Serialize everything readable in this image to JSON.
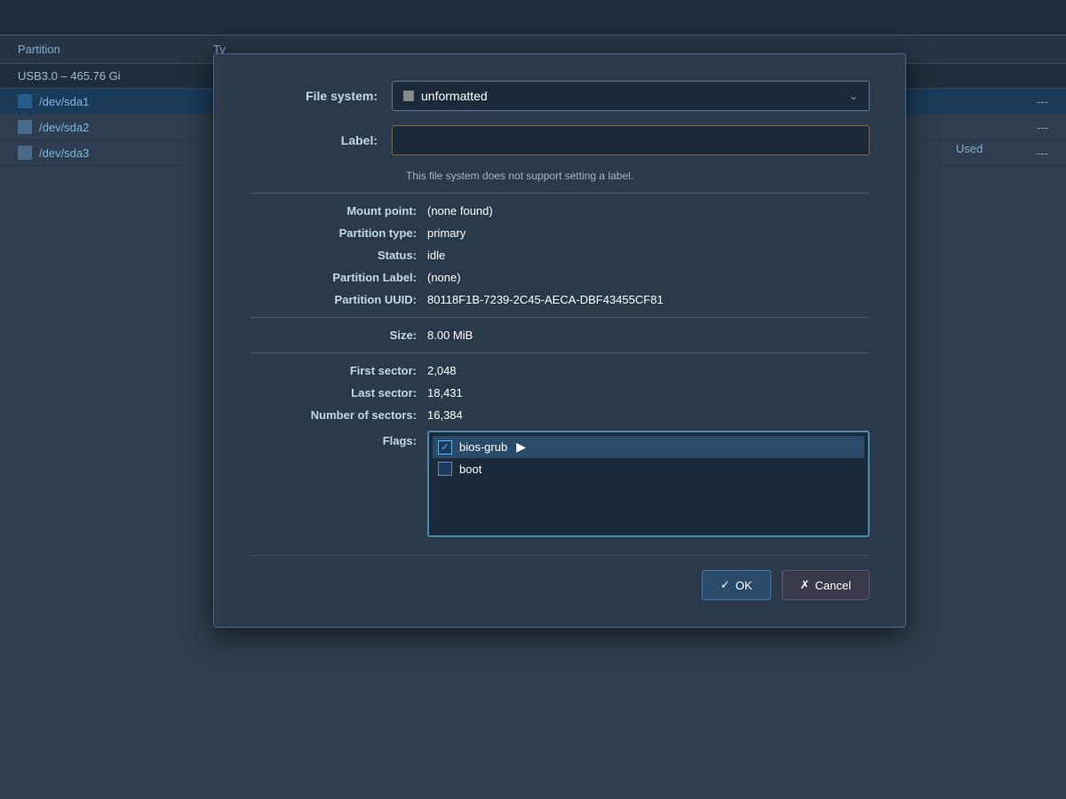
{
  "background": {
    "table_headers": {
      "partition": "Partition",
      "type": "Ty",
      "used": "Used"
    },
    "disk_label": "USB3.0 – 465.76 Gi",
    "partitions": [
      {
        "name": "/dev/sda1",
        "type": "",
        "dash": "---",
        "selected": true
      },
      {
        "name": "/dev/sda2",
        "type": "",
        "dash": "---",
        "selected": false
      },
      {
        "name": "/dev/sda3",
        "type": "",
        "dash": "---",
        "selected": false
      }
    ]
  },
  "dialog": {
    "filesystem_label": "File system:",
    "filesystem_value": "unformatted",
    "label_label": "Label:",
    "label_placeholder": "",
    "label_hint": "This file system does not support setting a label.",
    "mount_point_label": "Mount point:",
    "mount_point_value": "(none found)",
    "partition_type_label": "Partition type:",
    "partition_type_value": "primary",
    "status_label": "Status:",
    "status_value": "idle",
    "partition_label_label": "Partition Label:",
    "partition_label_value": "(none)",
    "uuid_label": "Partition UUID:",
    "uuid_value": "80118F1B-7239-2C45-AECA-DBF43455CF81",
    "size_label": "Size:",
    "size_value": "8.00 MiB",
    "first_sector_label": "First sector:",
    "first_sector_value": "2,048",
    "last_sector_label": "Last sector:",
    "last_sector_value": "18,431",
    "num_sectors_label": "Number of sectors:",
    "num_sectors_value": "16,384",
    "flags_label": "Flags:",
    "flags": [
      {
        "name": "bios-grub",
        "checked": true
      },
      {
        "name": "boot",
        "checked": false
      }
    ],
    "ok_button": "OK",
    "cancel_button": "Cancel"
  }
}
